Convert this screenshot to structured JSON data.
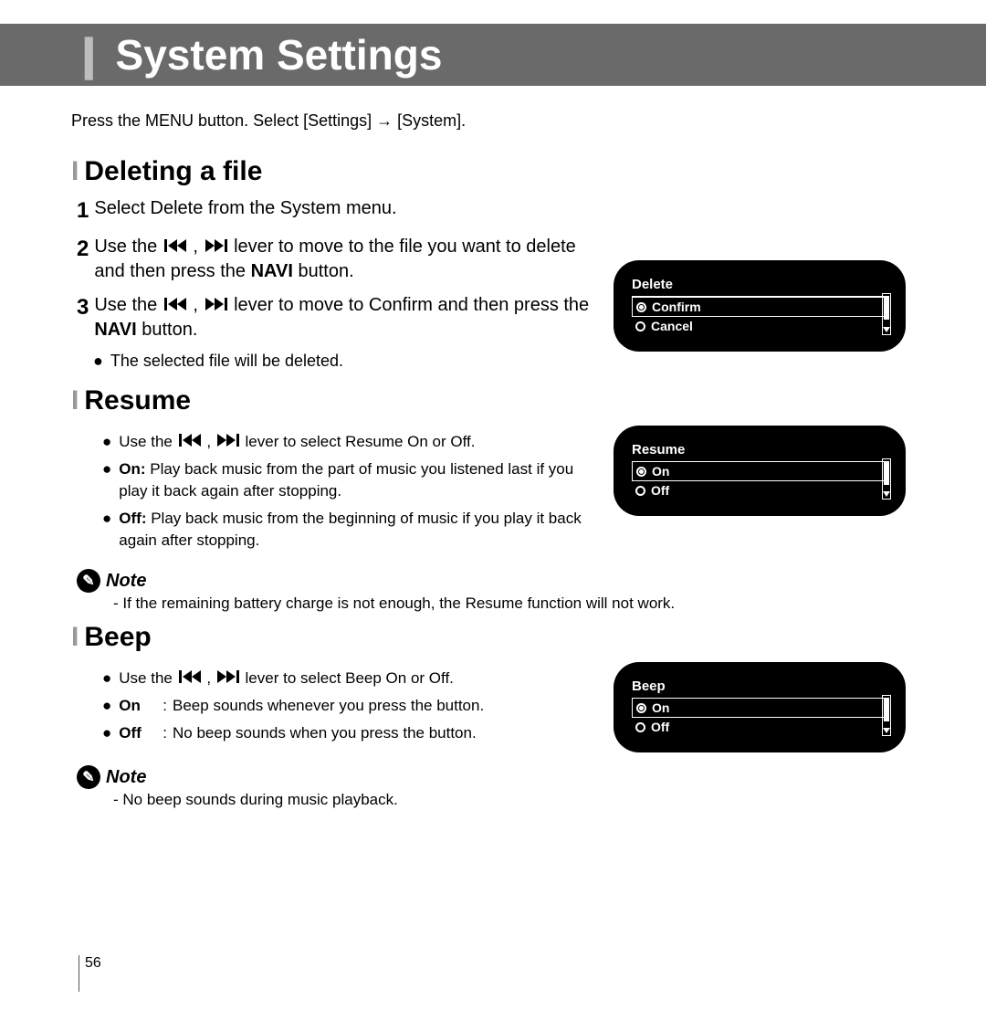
{
  "header": {
    "title": "System Settings"
  },
  "intro": "Press the MENU button. Select [Settings] → [System].",
  "sections": {
    "deleting": {
      "heading": "Deleting a file",
      "steps": [
        "Select Delete from the System menu.",
        "Use the , lever to move to the file you want to delete and then press the NAVI button.",
        "Use the , lever to move to Confirm and then press the NAVI button."
      ],
      "step2_pre": "Use the ",
      "step2_mid": " lever to move to the file you want to delete and then press the ",
      "step2_bold": "NAVI",
      "step2_post": " button.",
      "step3_pre": "Use the ",
      "step3_mid": " lever to move to Confirm and then press the ",
      "step3_bold": "NAVI",
      "step3_post": " button.",
      "result": "The selected file will be deleted.",
      "device": {
        "title": "Delete",
        "opt1": "Confirm",
        "opt2": "Cancel"
      }
    },
    "resume": {
      "heading": "Resume",
      "use_pre": "Use the ",
      "use_post": " lever  to select Resume On or Off.",
      "on_label": "On:",
      "on_text": " Play back music from the part of music you listened last if you play it back again after stopping.",
      "off_label": "Off:",
      "off_text": " Play back music from the beginning of music if you play it back again after stopping.",
      "note_label": "Note",
      "note_text": "- If the remaining battery charge is not enough, the Resume function will not work.",
      "device": {
        "title": "Resume",
        "opt1": "On",
        "opt2": "Off"
      }
    },
    "beep": {
      "heading": "Beep",
      "use_pre": "Use the ",
      "use_post": " lever  to select Beep On or Off.",
      "on_label": "On",
      "on_text": "Beep sounds whenever you press the button.",
      "off_label": "Off",
      "off_text": "No beep sounds when you press the button.",
      "note_label": "Note",
      "note_text": "- No beep sounds during music playback.",
      "device": {
        "title": "Beep",
        "opt1": "On",
        "opt2": "Off"
      }
    }
  },
  "comma": ",",
  "colon": ":",
  "page_number": "56"
}
